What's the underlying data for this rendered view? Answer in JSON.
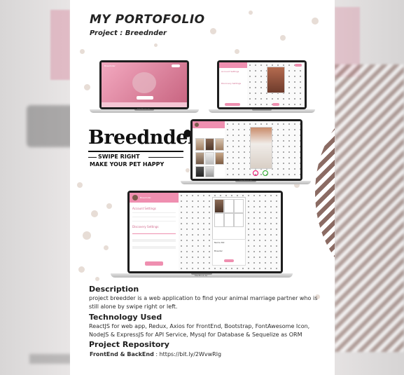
{
  "header": {
    "title": "MY PORTOFOLIO",
    "subtitle": "Project : Breednder"
  },
  "logo": {
    "wordmark": "Breednder",
    "tagline_1": "SWIPE RIGHT",
    "tagline_2": "MAKE YOUR PET HAPPY"
  },
  "mockups": {
    "laptop_label": "MacBook Air",
    "app_name": "Breednder",
    "account_settings": "Account Settings",
    "discovery_settings": "Discovery Settings",
    "logout": "Logout",
    "pet_name": "Name Pet",
    "breeder": "Breeder"
  },
  "description": {
    "heading": "Description",
    "text": "project breedder is a web application to find your animal marriage partner who is still alone by swipe right or left."
  },
  "technology": {
    "heading": "Technology Used",
    "text": "ReactJS for web app, Redux, Axios for FrontEnd, Bootstrap, FontAwesome Icon, NodeJS & ExpressJS for API Service, Mysql for Database & Sequelize as ORM"
  },
  "repository": {
    "heading": "Project Repository",
    "label": "FrontEnd & BackEnd",
    "link": "https://bit.ly/2WvwRlg"
  },
  "colors": {
    "accent_pink": "#ef8fb0",
    "stripe_brown": "#8b6b63"
  }
}
